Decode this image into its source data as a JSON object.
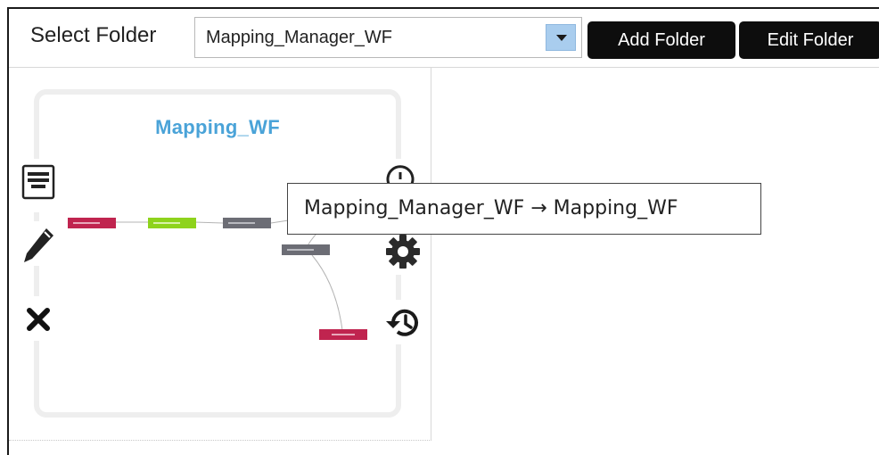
{
  "toolbar": {
    "select_label": "Select Folder",
    "folder_value": "Mapping_Manager_WF",
    "add_label": "Add Folder",
    "edit_label": "Edit Folder"
  },
  "workflow": {
    "title": "Mapping_WF",
    "tooltip": "Mapping_Manager_WF → Mapping_WF"
  },
  "colors": {
    "accent_title": "#4aa3d8",
    "node_crimson": "#c0244f",
    "node_green": "#8ed31c",
    "node_gray": "#6c6d75"
  },
  "icons": {
    "left": [
      "notes-icon",
      "pencil-icon",
      "close-icon"
    ],
    "right": [
      "info-icon",
      "gear-icon",
      "history-icon"
    ]
  }
}
